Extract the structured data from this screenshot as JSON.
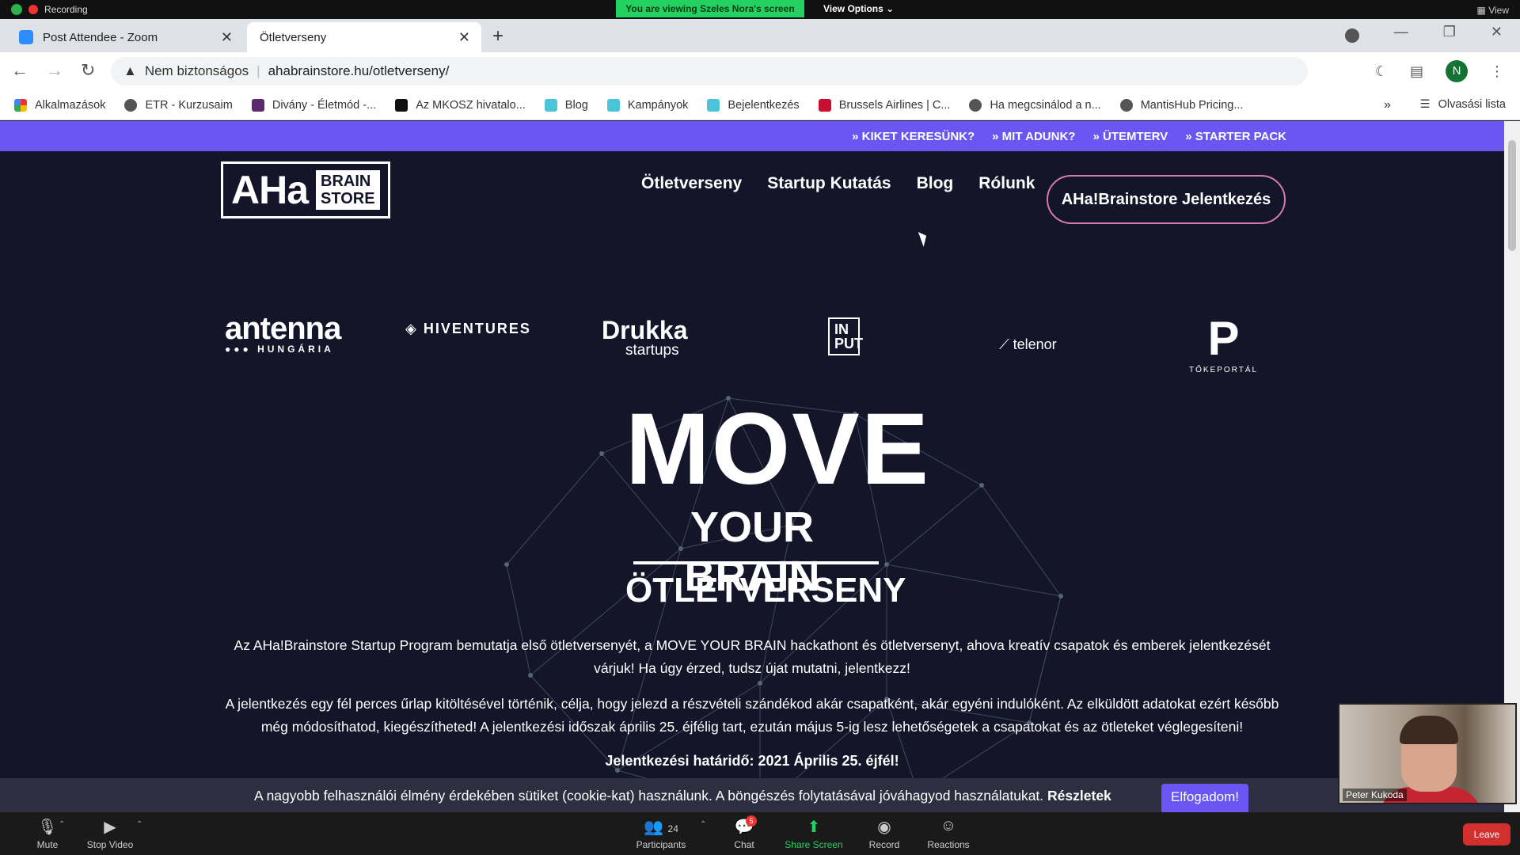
{
  "zoom_top": {
    "recording": "Recording",
    "viewing_banner": "You are viewing Szeles Nora's screen",
    "view_options": "View Options",
    "view": "View"
  },
  "tabs": [
    {
      "title": "Post Attendee - Zoom"
    },
    {
      "title": "Ötletverseny"
    }
  ],
  "address": {
    "security_label": "Nem biztonságos",
    "url": "ahabrainstore.hu/otletverseny/",
    "profile_initial": "N"
  },
  "bookmarks": [
    {
      "label": "Alkalmazások",
      "color": "#e33"
    },
    {
      "label": "ETR - Kurzusaim",
      "color": "#555"
    },
    {
      "label": "Divány - Életmód -...",
      "color": "#5b2b6e"
    },
    {
      "label": "Az MKOSZ hivatalo...",
      "color": "#111"
    },
    {
      "label": "Blog",
      "color": "#4cc3d9"
    },
    {
      "label": "Kampányok",
      "color": "#4cc3d9"
    },
    {
      "label": "Bejelentkezés",
      "color": "#4cc3d9"
    },
    {
      "label": "Brussels Airlines | C...",
      "color": "#c8102e"
    },
    {
      "label": "Ha megcsinálod a n...",
      "color": "#555"
    },
    {
      "label": "MantisHub Pricing...",
      "color": "#555"
    }
  ],
  "reading_list": "Olvasási lista",
  "site": {
    "topbar_links": [
      "» KIKET KERESÜNK?",
      "» MIT ADUNK?",
      "» ÜTEMTERV",
      "» STARTER PACK"
    ],
    "logo_main": "AHa",
    "logo_brain": "BRAIN",
    "logo_store": "STORE",
    "nav": [
      "Ötletverseny",
      "Startup Kutatás",
      "Blog",
      "Rólunk"
    ],
    "cta": "AHa!Brainstore Jelentkezés",
    "sponsors": {
      "antenna": "antenna",
      "antenna_sub": "●●● HUNGÁRIA",
      "hiventures": "HIVENTURES",
      "drukka": "Drukka",
      "drukka_sub": "startups",
      "input": "IN PUT",
      "telenor": "telenor",
      "tokeportal": "P",
      "tokeportal_sub": "TŐKEPORTÁL"
    },
    "hero_line1": "MOVE",
    "hero_line2": "YOUR BRAIN",
    "hero_line3": "ÖTLETVERSENY",
    "paragraph1": "Az AHa!Brainstore Startup Program bemutatja első ötletversenyét, a MOVE YOUR BRAIN hackathont és ötletversenyt, ahova kreatív csapatok és emberek jelentkezését várjuk! Ha úgy érzed, tudsz újat mutatni,  jelentkezz!",
    "paragraph2": "A jelentkezés egy fél perces űrlap kitöltésével történik, célja, hogy jelezd a részvételi szándékod akár csapatként, akár egyéni indulóként. Az elküldött adatokat ezért később még módosíthatod, kiegészítheted! A jelentkezési időszak április 25. éjfélig tart, ezután május 5-ig lesz lehetőségetek a csapatokat és az ötleteket véglegesíteni!",
    "deadline": "Jelentkezési határidő: 2021 Április 25. éjfél!",
    "cookie_text": "A nagyobb felhasználói élmény érdekében sütiket (cookie-kat) használunk. A böngészés folytatásával jóváhagyod használatukat.",
    "cookie_link": "Részletek",
    "cookie_button": "Elfogadom!"
  },
  "video": {
    "name": "Peter Kukoda"
  },
  "zoombar": {
    "mute": "Mute",
    "stop_video": "Stop Video",
    "participants": "Participants",
    "participants_count": "24",
    "chat": "Chat",
    "chat_badge": "5",
    "share": "Share Screen",
    "record": "Record",
    "reactions": "Reactions",
    "leave": "Leave"
  }
}
